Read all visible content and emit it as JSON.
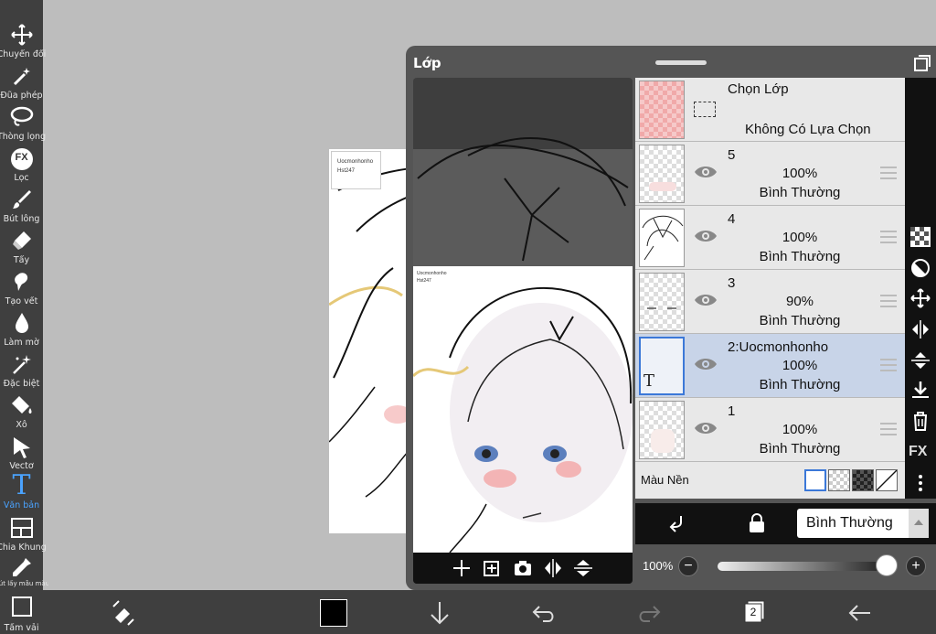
{
  "toolbar": {
    "items": [
      {
        "label": "Chuyển đổi",
        "icon": "move-icon"
      },
      {
        "label": "Đũa phép",
        "icon": "magic-wand-icon"
      },
      {
        "label": "Thòng lọng",
        "icon": "lasso-icon"
      },
      {
        "label": "Lọc",
        "icon": "fx-icon",
        "badge": "FX"
      },
      {
        "label": "Bút lông",
        "icon": "brush-icon"
      },
      {
        "label": "Tẩy",
        "icon": "eraser-icon"
      },
      {
        "label": "Tạo vết",
        "icon": "smudge-icon"
      },
      {
        "label": "Làm mờ",
        "icon": "blur-drop-icon"
      },
      {
        "label": "Đặc biệt",
        "icon": "sparkle-icon"
      },
      {
        "label": "Xô",
        "icon": "bucket-icon"
      },
      {
        "label": "Vectơ",
        "icon": "vector-cursor-icon"
      },
      {
        "label": "Văn bản",
        "icon": "text-tool-icon",
        "glyph": "T"
      },
      {
        "label": "Chia Khung",
        "icon": "frame-divider-icon"
      },
      {
        "label": "Bút lấy mẫu màu",
        "icon": "eyedropper-icon"
      },
      {
        "label": "Tấm vải",
        "icon": "canvas-icon"
      }
    ]
  },
  "canvas": {
    "note_line1": "Uocmonhonho",
    "note_line2": "Hst247"
  },
  "panel": {
    "title": "Lớp",
    "selection_layer": {
      "title": "Chọn Lớp",
      "subtitle": "Không Có Lựa Chọn"
    },
    "layers": [
      {
        "name": "5",
        "opacity": "100%",
        "blend": "Bình Thường",
        "selected": false
      },
      {
        "name": "4",
        "opacity": "100%",
        "blend": "Bình Thường",
        "selected": false
      },
      {
        "name": "3",
        "opacity": "90%",
        "blend": "Bình Thường",
        "selected": false
      },
      {
        "name": "2:Uocmonhonho",
        "opacity": "100%",
        "blend": "Bình Thường",
        "selected": true,
        "thumb_glyph": "T"
      },
      {
        "name": "1",
        "opacity": "100%",
        "blend": "Bình Thường",
        "selected": false
      }
    ],
    "background_label": "Màu Nền",
    "side_fx": "FX",
    "blend_mode": "Bình Thường",
    "opacity_label": "100%",
    "opacity_value": 1.0,
    "minus": "−",
    "plus": "+",
    "preview_note_line1": "Uocmonhonho",
    "preview_note_line2": "Hst247"
  },
  "bottombar": {
    "layer_count": "2",
    "color": "#000000"
  },
  "colors": {
    "accent": "#3b78d8",
    "toolbar_bg": "#3f3f3f",
    "panel_bg": "#555555"
  }
}
